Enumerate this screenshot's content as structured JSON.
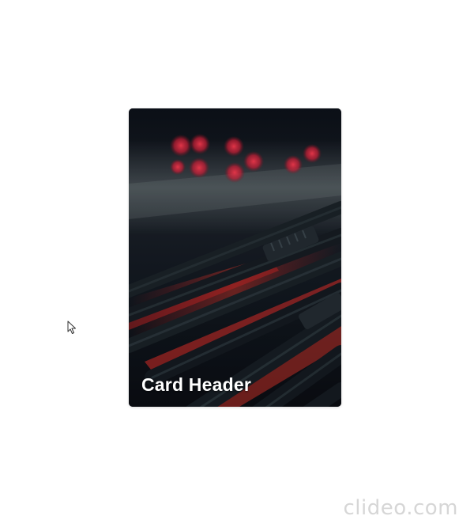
{
  "card": {
    "header": "Card Header",
    "image": "network-cables-photo"
  },
  "cursor": {
    "icon": "mouse-pointer-icon"
  },
  "watermark": {
    "text": "clideo.com"
  },
  "colors": {
    "background": "#ffffff",
    "card_base": "#0c1017",
    "accent_red": "#e0243a",
    "header_text": "#ffffff"
  }
}
